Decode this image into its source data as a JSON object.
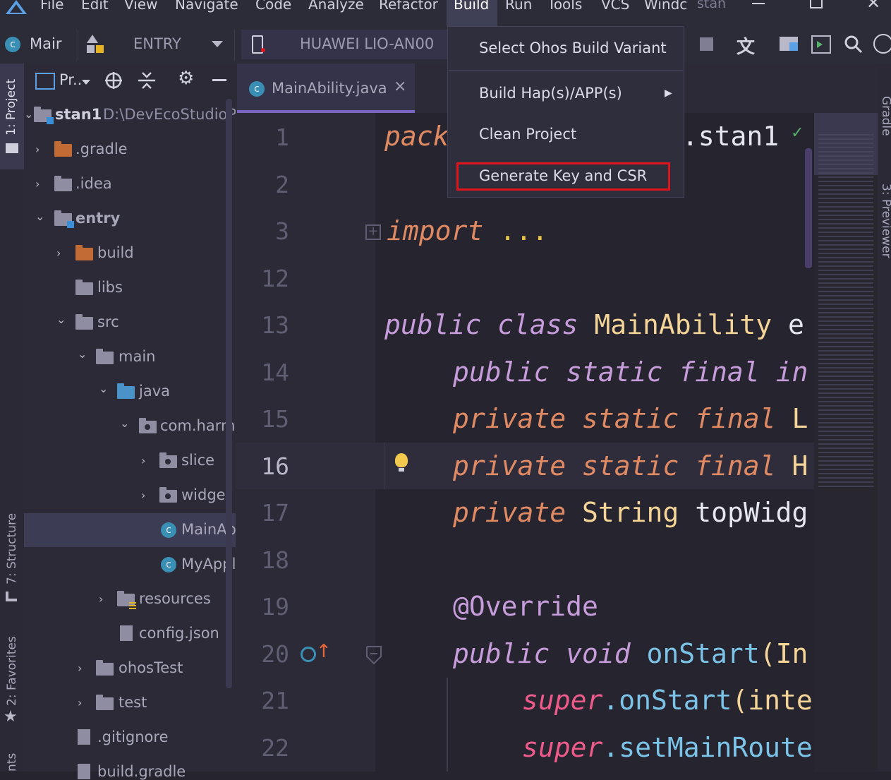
{
  "menubar": {
    "items": [
      "File",
      "Edit",
      "View",
      "Navigate",
      "Code",
      "Analyze",
      "Refactor",
      "Build",
      "Run",
      "Tools",
      "VCS",
      "Windc",
      "stan"
    ],
    "active": "Build"
  },
  "toolbar": {
    "module_label": "Mair",
    "config_label": "ENTRY",
    "device_label": "HUAWEI LIO-AN00"
  },
  "build_menu": {
    "items": [
      {
        "label": "Select Ohos Build Variant"
      },
      {
        "label": "Build Hap(s)/APP(s)",
        "submenu_arrow": "▶"
      },
      {
        "label": "Clean Project"
      },
      {
        "label": "Generate Key and CSR",
        "highlighted": true
      }
    ],
    "highlight_color": "#e0141a"
  },
  "left_strip": {
    "project_tab": "1: Project",
    "structure_tab": "7: Structure",
    "favorites_tab": "2: Favorites",
    "bottom_fragment": "nts"
  },
  "right_strip": {
    "gradle_tab": "Gradle",
    "previewer_tab": "3: Previewer"
  },
  "project_panel": {
    "header_label": "Pr..",
    "root_name": "stan1",
    "root_path": "D:\\DevEcoStudioPr",
    "tree": [
      {
        "label": ".gradle"
      },
      {
        "label": ".idea"
      },
      {
        "label": "entry"
      },
      {
        "label": "build"
      },
      {
        "label": "libs"
      },
      {
        "label": "src"
      },
      {
        "label": "main"
      },
      {
        "label": "java"
      },
      {
        "label": "com.harmo"
      },
      {
        "label": "slice"
      },
      {
        "label": "widget"
      },
      {
        "label": "MainAb"
      },
      {
        "label": "MyAppl"
      },
      {
        "label": "resources"
      },
      {
        "label": "config.json"
      },
      {
        "label": "ohosTest"
      },
      {
        "label": "test"
      },
      {
        "label": ".gitignore"
      },
      {
        "label": "build.gradle"
      }
    ]
  },
  "editor": {
    "tab_label": "MainAbility.java",
    "tab_close": "×",
    "line_numbers": [
      "1",
      "2",
      "3",
      "12",
      "13",
      "14",
      "15",
      "16",
      "17",
      "18",
      "19",
      "20",
      "21",
      "22"
    ],
    "code": {
      "l1_kw": "pack",
      "l1_rest": "y.stan1",
      "l3_kw": "import",
      "l3_rest": " ...",
      "l13_kw": "public class ",
      "l13_cls": "MainAbility",
      "l13_rest": " e",
      "l14": "public static final ",
      "l14_rest": "in",
      "l15": "private static final ",
      "l15_rest": "L",
      "l16": "private static final ",
      "l16_rest": "H",
      "l17_kw": "private ",
      "l17_cls": "String",
      "l17_rest": " topWidg",
      "l19": "@Override",
      "l20_kw": "public void ",
      "l20_fn": "onStart",
      "l20_rest": "(In",
      "l21_sup": "super",
      "l21_fn": ".onStart",
      "l21_rest": "(inte",
      "l22_sup": "super",
      "l22_fn": ".setMainRoute"
    }
  }
}
